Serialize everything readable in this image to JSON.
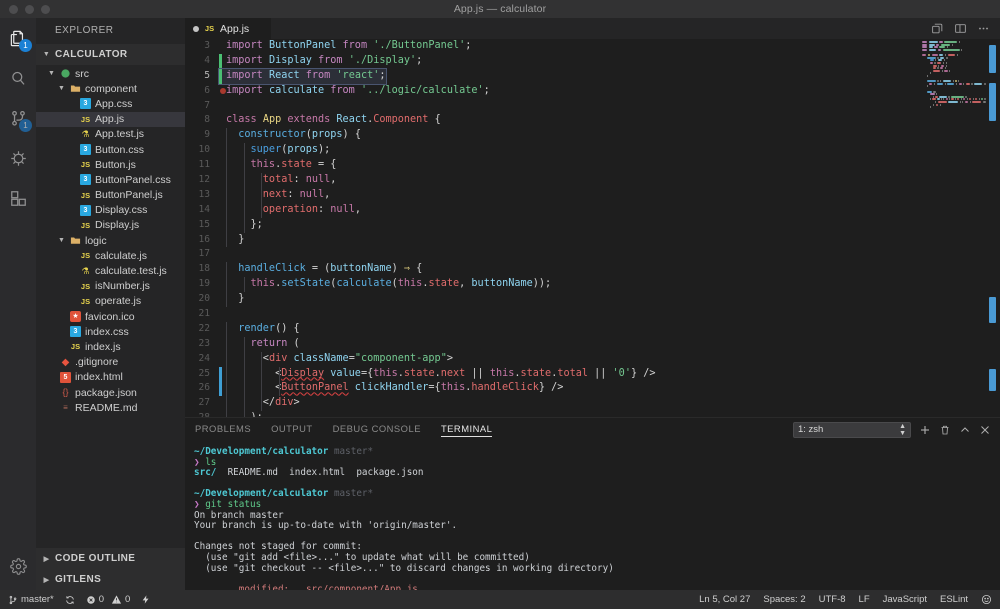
{
  "window": {
    "title": "App.js — calculator"
  },
  "activitybar": {
    "items": [
      {
        "name": "explorer",
        "badge": "1",
        "active": true
      },
      {
        "name": "search",
        "badge": "",
        "active": false
      },
      {
        "name": "source-control",
        "badge": "1",
        "active": false
      },
      {
        "name": "debug",
        "badge": "",
        "active": false
      },
      {
        "name": "extensions",
        "badge": "",
        "active": false
      }
    ],
    "settings_label": "manage-gear"
  },
  "sidebar": {
    "title": "EXPLORER",
    "root": "CALCULATOR",
    "tree": [
      {
        "label": "src",
        "indent": 1,
        "type": "folder-src",
        "twisty": "open"
      },
      {
        "label": "component",
        "indent": 2,
        "type": "folder",
        "twisty": "open"
      },
      {
        "label": "App.css",
        "indent": 3,
        "type": "css"
      },
      {
        "label": "App.js",
        "indent": 3,
        "type": "js",
        "selected": true
      },
      {
        "label": "App.test.js",
        "indent": 3,
        "type": "test"
      },
      {
        "label": "Button.css",
        "indent": 3,
        "type": "css"
      },
      {
        "label": "Button.js",
        "indent": 3,
        "type": "js"
      },
      {
        "label": "ButtonPanel.css",
        "indent": 3,
        "type": "css"
      },
      {
        "label": "ButtonPanel.js",
        "indent": 3,
        "type": "js"
      },
      {
        "label": "Display.css",
        "indent": 3,
        "type": "css"
      },
      {
        "label": "Display.js",
        "indent": 3,
        "type": "js"
      },
      {
        "label": "logic",
        "indent": 2,
        "type": "folder",
        "twisty": "open"
      },
      {
        "label": "calculate.js",
        "indent": 3,
        "type": "js"
      },
      {
        "label": "calculate.test.js",
        "indent": 3,
        "type": "test"
      },
      {
        "label": "isNumber.js",
        "indent": 3,
        "type": "js"
      },
      {
        "label": "operate.js",
        "indent": 3,
        "type": "js"
      },
      {
        "label": "favicon.ico",
        "indent": 2,
        "type": "ico"
      },
      {
        "label": "index.css",
        "indent": 2,
        "type": "css"
      },
      {
        "label": "index.js",
        "indent": 2,
        "type": "js"
      },
      {
        "label": ".gitignore",
        "indent": 1,
        "type": "git"
      },
      {
        "label": "index.html",
        "indent": 1,
        "type": "html"
      },
      {
        "label": "package.json",
        "indent": 1,
        "type": "json"
      },
      {
        "label": "README.md",
        "indent": 1,
        "type": "md"
      }
    ],
    "sections": [
      {
        "label": "CODE OUTLINE"
      },
      {
        "label": "GITLENS"
      }
    ]
  },
  "editor": {
    "tabs": [
      {
        "label": "App.js",
        "icon": "js-icon",
        "dirty": true,
        "active": true
      }
    ],
    "actions": [
      "split-editor-vertical-icon",
      "layout-panel-icon",
      "more-actions-icon"
    ],
    "first_line": 3,
    "lines": [
      {
        "n": 3,
        "git": "",
        "tokens": [
          [
            "t-kw2",
            "import "
          ],
          [
            "t-var",
            "ButtonPanel"
          ],
          [
            "t-kw2",
            " from "
          ],
          [
            "t-str",
            "'./ButtonPanel'"
          ],
          [
            "t-punc",
            ";"
          ]
        ]
      },
      {
        "n": 4,
        "git": "added",
        "tokens": [
          [
            "t-kw2",
            "import "
          ],
          [
            "t-var",
            "Display"
          ],
          [
            "t-kw2",
            " from "
          ],
          [
            "t-str",
            "'./Display'"
          ],
          [
            "t-punc",
            ";"
          ]
        ]
      },
      {
        "n": 5,
        "git": "added",
        "sel": true,
        "tokens": [
          [
            "t-kw2",
            "import "
          ],
          [
            "t-var",
            "React"
          ],
          [
            "t-kw2",
            " from "
          ],
          [
            "t-str",
            "'react'"
          ],
          [
            "t-punc",
            ";"
          ]
        ]
      },
      {
        "n": 6,
        "git": "",
        "bp": true,
        "tokens": [
          [
            "t-kw2",
            "import "
          ],
          [
            "t-var",
            "calculate"
          ],
          [
            "t-kw2",
            " from "
          ],
          [
            "t-str",
            "'../logic/calculate'"
          ],
          [
            "t-punc",
            ";"
          ]
        ]
      },
      {
        "n": 7,
        "git": "",
        "tokens": []
      },
      {
        "n": 8,
        "git": "",
        "tokens": [
          [
            "t-kw",
            "class "
          ],
          [
            "t-cls",
            "App"
          ],
          [
            "t-kw",
            " extends "
          ],
          [
            "t-var",
            "React"
          ],
          [
            "t-punc",
            "."
          ],
          [
            "t-comp",
            "Component"
          ],
          [
            "t-punc",
            " {"
          ]
        ]
      },
      {
        "n": 9,
        "git": "",
        "indent": 1,
        "tokens": [
          [
            "t-fn",
            "  constructor"
          ],
          [
            "t-punc",
            "("
          ],
          [
            "t-var",
            "props"
          ],
          [
            "t-punc",
            ") {"
          ]
        ]
      },
      {
        "n": 10,
        "git": "",
        "indent": 2,
        "tokens": [
          [
            "t-const",
            "    super"
          ],
          [
            "t-punc",
            "("
          ],
          [
            "t-var",
            "props"
          ],
          [
            "t-punc",
            ");"
          ]
        ]
      },
      {
        "n": 11,
        "git": "",
        "indent": 2,
        "tokens": [
          [
            "t-this",
            "    this"
          ],
          [
            "t-punc",
            "."
          ],
          [
            "t-prop",
            "state"
          ],
          [
            "t-op",
            " = "
          ],
          [
            "t-punc",
            "{"
          ]
        ]
      },
      {
        "n": 12,
        "git": "",
        "indent": 3,
        "tokens": [
          [
            "t-prop",
            "      total"
          ],
          [
            "t-punc",
            ": "
          ],
          [
            "t-kw",
            "null"
          ],
          [
            "t-punc",
            ","
          ]
        ]
      },
      {
        "n": 13,
        "git": "",
        "indent": 3,
        "tokens": [
          [
            "t-prop",
            "      next"
          ],
          [
            "t-punc",
            ": "
          ],
          [
            "t-kw",
            "null"
          ],
          [
            "t-punc",
            ","
          ]
        ]
      },
      {
        "n": 14,
        "git": "",
        "indent": 3,
        "tokens": [
          [
            "t-prop",
            "      operation"
          ],
          [
            "t-punc",
            ": "
          ],
          [
            "t-kw",
            "null"
          ],
          [
            "t-punc",
            ","
          ]
        ]
      },
      {
        "n": 15,
        "git": "",
        "indent": 2,
        "tokens": [
          [
            "t-punc",
            "    };"
          ]
        ]
      },
      {
        "n": 16,
        "git": "",
        "indent": 1,
        "tokens": [
          [
            "t-punc",
            "  }"
          ]
        ]
      },
      {
        "n": 17,
        "git": "",
        "tokens": []
      },
      {
        "n": 18,
        "git": "",
        "indent": 1,
        "tokens": [
          [
            "t-fn",
            "  handleClick"
          ],
          [
            "t-op",
            " = "
          ],
          [
            "t-punc",
            "("
          ],
          [
            "t-var",
            "buttonName"
          ],
          [
            "t-punc",
            ") "
          ],
          [
            "t-cls",
            "⇒"
          ],
          [
            "t-punc",
            " {"
          ]
        ]
      },
      {
        "n": 19,
        "git": "",
        "indent": 2,
        "tokens": [
          [
            "t-this",
            "    this"
          ],
          [
            "t-punc",
            "."
          ],
          [
            "t-fn",
            "setState"
          ],
          [
            "t-punc",
            "("
          ],
          [
            "t-fn",
            "calculate"
          ],
          [
            "t-punc",
            "("
          ],
          [
            "t-this",
            "this"
          ],
          [
            "t-punc",
            "."
          ],
          [
            "t-prop",
            "state"
          ],
          [
            "t-punc",
            ", "
          ],
          [
            "t-var",
            "buttonName"
          ],
          [
            "t-punc",
            "));"
          ]
        ]
      },
      {
        "n": 20,
        "git": "",
        "indent": 1,
        "tokens": [
          [
            "t-punc",
            "  }"
          ]
        ]
      },
      {
        "n": 21,
        "git": "",
        "tokens": []
      },
      {
        "n": 22,
        "git": "",
        "indent": 1,
        "tokens": [
          [
            "t-fn",
            "  render"
          ],
          [
            "t-punc",
            "() {"
          ]
        ]
      },
      {
        "n": 23,
        "git": "",
        "indent": 2,
        "tokens": [
          [
            "t-kw2",
            "    return"
          ],
          [
            "t-punc",
            " ("
          ]
        ]
      },
      {
        "n": 24,
        "git": "",
        "indent": 3,
        "tokens": [
          [
            "t-punc",
            "      <"
          ],
          [
            "t-tag",
            "div"
          ],
          [
            "t-attr",
            " className"
          ],
          [
            "t-op",
            "="
          ],
          [
            "t-str",
            "\"component-app\""
          ],
          [
            "t-punc",
            ">"
          ]
        ]
      },
      {
        "n": 25,
        "git": "mod",
        "indent": 4,
        "tokens": [
          [
            "t-punc",
            "        <"
          ],
          [
            "t-comp err-underline",
            "Display"
          ],
          [
            "t-attr",
            " value"
          ],
          [
            "t-op",
            "="
          ],
          [
            "t-punc",
            "{"
          ],
          [
            "t-this",
            "this"
          ],
          [
            "t-punc",
            "."
          ],
          [
            "t-prop",
            "state"
          ],
          [
            "t-punc",
            "."
          ],
          [
            "t-prop",
            "next"
          ],
          [
            "t-op",
            " || "
          ],
          [
            "t-this",
            "this"
          ],
          [
            "t-punc",
            "."
          ],
          [
            "t-prop",
            "state"
          ],
          [
            "t-punc",
            "."
          ],
          [
            "t-prop",
            "total"
          ],
          [
            "t-op",
            " || "
          ],
          [
            "t-str",
            "'0'"
          ],
          [
            "t-punc",
            "} />"
          ]
        ]
      },
      {
        "n": 26,
        "git": "mod",
        "indent": 4,
        "tokens": [
          [
            "t-punc",
            "        <"
          ],
          [
            "t-comp err-underline",
            "ButtonPanel"
          ],
          [
            "t-attr",
            " clickHandler"
          ],
          [
            "t-op",
            "="
          ],
          [
            "t-punc",
            "{"
          ],
          [
            "t-this",
            "this"
          ],
          [
            "t-punc",
            "."
          ],
          [
            "t-prop",
            "handleClick"
          ],
          [
            "t-punc",
            "} />"
          ]
        ]
      },
      {
        "n": 27,
        "git": "",
        "indent": 3,
        "tokens": [
          [
            "t-punc",
            "      </"
          ],
          [
            "t-tag",
            "div"
          ],
          [
            "t-punc",
            ">"
          ]
        ]
      },
      {
        "n": 28,
        "git": "",
        "indent": 2,
        "tokens": [
          [
            "t-punc",
            "    );"
          ]
        ]
      }
    ]
  },
  "panel": {
    "tabs": [
      {
        "label": "PROBLEMS",
        "active": false
      },
      {
        "label": "OUTPUT",
        "active": false
      },
      {
        "label": "DEBUG CONSOLE",
        "active": false
      },
      {
        "label": "TERMINAL",
        "active": true
      }
    ],
    "terminal_select": "1: zsh",
    "actions": [
      "add-terminal-icon",
      "kill-terminal-icon",
      "maximize-panel-icon",
      "close-panel-icon"
    ],
    "terminal_lines": [
      [
        [
          "tm-cyan",
          "~/Development/calculator"
        ],
        [
          "tm-gray",
          " master*"
        ]
      ],
      [
        [
          "tm-mag",
          "❯ "
        ],
        [
          "tm-green",
          "ls"
        ]
      ],
      [
        [
          "tm-cyan",
          "src/"
        ],
        [
          "tm-white",
          "  README.md  index.html  package.json"
        ]
      ],
      [
        [
          "tm-white",
          ""
        ]
      ],
      [
        [
          "tm-cyan",
          "~/Development/calculator"
        ],
        [
          "tm-gray",
          " master*"
        ]
      ],
      [
        [
          "tm-mag",
          "❯ "
        ],
        [
          "tm-green",
          "git status"
        ]
      ],
      [
        [
          "tm-white",
          "On branch master"
        ]
      ],
      [
        [
          "tm-white",
          "Your branch is up-to-date with 'origin/master'."
        ]
      ],
      [
        [
          "tm-white",
          ""
        ]
      ],
      [
        [
          "tm-white",
          "Changes not staged for commit:"
        ]
      ],
      [
        [
          "tm-white",
          "  (use \"git add <file>...\" to update what will be committed)"
        ]
      ],
      [
        [
          "tm-white",
          "  (use \"git checkout -- <file>...\" to discard changes in working directory)"
        ]
      ],
      [
        [
          "tm-white",
          ""
        ]
      ],
      [
        [
          "tm-red",
          "        modified:   src/component/App.js"
        ]
      ]
    ]
  },
  "statusbar": {
    "branch": "master*",
    "sync_icon": "sync-icon",
    "errors": "0",
    "warnings": "0",
    "lightning_icon": "lightning-icon",
    "position": "Ln 5, Col 27",
    "spaces": "Spaces: 2",
    "encoding": "UTF-8",
    "eol": "LF",
    "language": "JavaScript",
    "linter": "ESLint",
    "feedback_icon": "smiley-icon"
  },
  "colors": {
    "accent": "#1b80d4",
    "git_added": "#4bbf73",
    "git_modified": "#3f9fd4",
    "error": "#d04040"
  }
}
